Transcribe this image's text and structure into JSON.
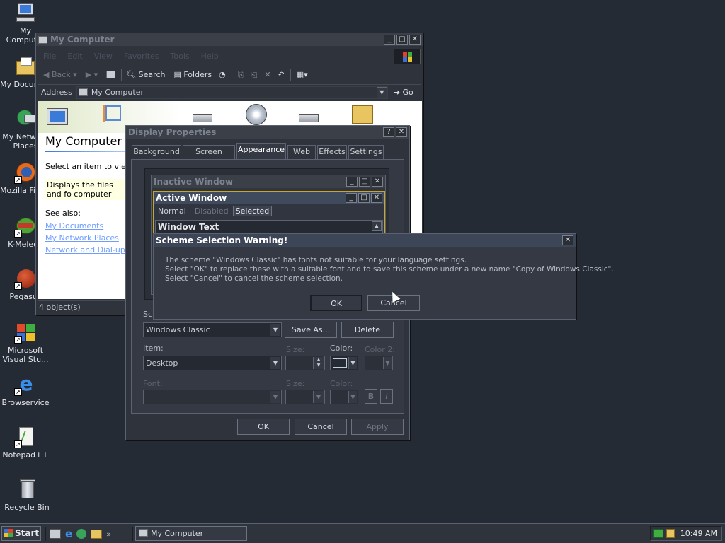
{
  "desktop": {
    "icons": [
      {
        "label": "My Computer"
      },
      {
        "label": "My Documents"
      },
      {
        "label": "My Network Places"
      },
      {
        "label": "Mozilla Firefox"
      },
      {
        "label": "K-Meleon"
      },
      {
        "label": "Pegasus"
      },
      {
        "label": "Microsoft Visual Stu..."
      },
      {
        "label": "Browservice"
      },
      {
        "label": "Notepad++"
      },
      {
        "label": "Recycle Bin"
      }
    ]
  },
  "mycomputer": {
    "title": "My Computer",
    "menu": [
      "File",
      "Edit",
      "View",
      "Favorites",
      "Tools",
      "Help"
    ],
    "toolbar": {
      "back": "Back",
      "search": "Search",
      "folders": "Folders"
    },
    "address_label": "Address",
    "address_value": "My Computer",
    "go": "Go",
    "panel_title": "My Computer",
    "select_text": "Select an item to view i",
    "desc_text": "Displays the files and fo computer",
    "see_also": "See also:",
    "links": [
      "My Documents",
      "My Network Places",
      "Network and Dial-up Co"
    ],
    "status": "4 object(s)"
  },
  "display": {
    "title": "Display Properties",
    "help": "?",
    "close": "✕",
    "tabs": [
      "Background",
      "Screen Saver",
      "Appearance",
      "Web",
      "Effects",
      "Settings"
    ],
    "preview": {
      "inactive_title": "Inactive Window",
      "active_title": "Active Window",
      "menu": [
        "Normal",
        "Disabled",
        "Selected"
      ],
      "window_text": "Window Text"
    },
    "scheme_label": "Scl",
    "scheme_value": "Windows Classic",
    "save_as": "Save As...",
    "delete": "Delete",
    "item_label": "Item:",
    "item_value": "Desktop",
    "size_label": "Size:",
    "color_label": "Color:",
    "color2_label": "Color 2:",
    "font_label": "Font:",
    "font_size_label": "Size:",
    "font_color_label": "Color:",
    "bold": "B",
    "italic": "I",
    "ok": "OK",
    "cancel": "Cancel",
    "apply": "Apply"
  },
  "warning": {
    "title": "Scheme Selection Warning!",
    "line1": "The scheme \"Windows Classic\" has fonts not suitable for your language settings.",
    "line2": "Select \"OK\" to replace these with a suitable font and to save this scheme under a new name \"Copy of Windows Classic\".",
    "line3": "Select \"Cancel\" to cancel the scheme selection.",
    "ok": "OK",
    "cancel": "Cancel"
  },
  "taskbar": {
    "start": "Start",
    "task": "My Computer",
    "clock": "10:49 AM"
  },
  "colors": {
    "desktop": "#252b35",
    "active_title": "#3f4a5c",
    "link": "#6f9dff"
  }
}
